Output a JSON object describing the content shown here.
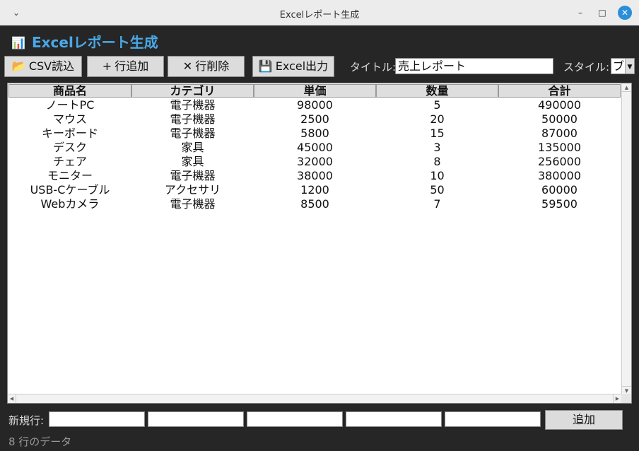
{
  "window": {
    "title": "Excelレポート生成"
  },
  "header": {
    "title": "Excelレポート生成",
    "icon": "bar-chart-icon"
  },
  "toolbar": {
    "csv_import": "CSV読込",
    "add_row": "行追加",
    "delete_row": "行削除",
    "export_excel": "Excel出力",
    "title_label": "タイトル:",
    "title_value": "売上レポート",
    "style_label": "スタイル:",
    "style_value": "ブル"
  },
  "table": {
    "columns": [
      "商品名",
      "カテゴリ",
      "単価",
      "数量",
      "合計"
    ],
    "rows": [
      [
        "ノートPC",
        "電子機器",
        "98000",
        "5",
        "490000"
      ],
      [
        "マウス",
        "電子機器",
        "2500",
        "20",
        "50000"
      ],
      [
        "キーボード",
        "電子機器",
        "5800",
        "15",
        "87000"
      ],
      [
        "デスク",
        "家具",
        "45000",
        "3",
        "135000"
      ],
      [
        "チェア",
        "家具",
        "32000",
        "8",
        "256000"
      ],
      [
        "モニター",
        "電子機器",
        "38000",
        "10",
        "380000"
      ],
      [
        "USB-Cケーブル",
        "アクセサリ",
        "1200",
        "50",
        "60000"
      ],
      [
        "Webカメラ",
        "電子機器",
        "8500",
        "7",
        "59500"
      ]
    ]
  },
  "new_row": {
    "label": "新規行:",
    "add_button": "追加"
  },
  "status": {
    "text": "8 行のデータ"
  },
  "colors": {
    "accent": "#4aa8e8",
    "background": "#262626"
  }
}
